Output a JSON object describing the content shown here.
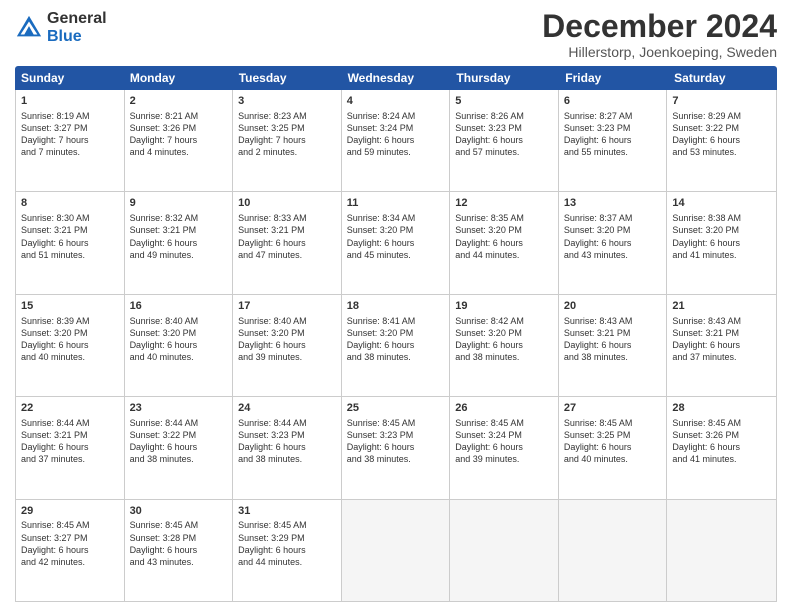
{
  "logo": {
    "general": "General",
    "blue": "Blue"
  },
  "title": "December 2024",
  "location": "Hillerstorp, Joenkoeping, Sweden",
  "days": [
    "Sunday",
    "Monday",
    "Tuesday",
    "Wednesday",
    "Thursday",
    "Friday",
    "Saturday"
  ],
  "weeks": [
    [
      {
        "day": 1,
        "info": "Sunrise: 8:19 AM\nSunset: 3:27 PM\nDaylight: 7 hours\nand 7 minutes."
      },
      {
        "day": 2,
        "info": "Sunrise: 8:21 AM\nSunset: 3:26 PM\nDaylight: 7 hours\nand 4 minutes."
      },
      {
        "day": 3,
        "info": "Sunrise: 8:23 AM\nSunset: 3:25 PM\nDaylight: 7 hours\nand 2 minutes."
      },
      {
        "day": 4,
        "info": "Sunrise: 8:24 AM\nSunset: 3:24 PM\nDaylight: 6 hours\nand 59 minutes."
      },
      {
        "day": 5,
        "info": "Sunrise: 8:26 AM\nSunset: 3:23 PM\nDaylight: 6 hours\nand 57 minutes."
      },
      {
        "day": 6,
        "info": "Sunrise: 8:27 AM\nSunset: 3:23 PM\nDaylight: 6 hours\nand 55 minutes."
      },
      {
        "day": 7,
        "info": "Sunrise: 8:29 AM\nSunset: 3:22 PM\nDaylight: 6 hours\nand 53 minutes."
      }
    ],
    [
      {
        "day": 8,
        "info": "Sunrise: 8:30 AM\nSunset: 3:21 PM\nDaylight: 6 hours\nand 51 minutes."
      },
      {
        "day": 9,
        "info": "Sunrise: 8:32 AM\nSunset: 3:21 PM\nDaylight: 6 hours\nand 49 minutes."
      },
      {
        "day": 10,
        "info": "Sunrise: 8:33 AM\nSunset: 3:21 PM\nDaylight: 6 hours\nand 47 minutes."
      },
      {
        "day": 11,
        "info": "Sunrise: 8:34 AM\nSunset: 3:20 PM\nDaylight: 6 hours\nand 45 minutes."
      },
      {
        "day": 12,
        "info": "Sunrise: 8:35 AM\nSunset: 3:20 PM\nDaylight: 6 hours\nand 44 minutes."
      },
      {
        "day": 13,
        "info": "Sunrise: 8:37 AM\nSunset: 3:20 PM\nDaylight: 6 hours\nand 43 minutes."
      },
      {
        "day": 14,
        "info": "Sunrise: 8:38 AM\nSunset: 3:20 PM\nDaylight: 6 hours\nand 41 minutes."
      }
    ],
    [
      {
        "day": 15,
        "info": "Sunrise: 8:39 AM\nSunset: 3:20 PM\nDaylight: 6 hours\nand 40 minutes."
      },
      {
        "day": 16,
        "info": "Sunrise: 8:40 AM\nSunset: 3:20 PM\nDaylight: 6 hours\nand 40 minutes."
      },
      {
        "day": 17,
        "info": "Sunrise: 8:40 AM\nSunset: 3:20 PM\nDaylight: 6 hours\nand 39 minutes."
      },
      {
        "day": 18,
        "info": "Sunrise: 8:41 AM\nSunset: 3:20 PM\nDaylight: 6 hours\nand 38 minutes."
      },
      {
        "day": 19,
        "info": "Sunrise: 8:42 AM\nSunset: 3:20 PM\nDaylight: 6 hours\nand 38 minutes."
      },
      {
        "day": 20,
        "info": "Sunrise: 8:43 AM\nSunset: 3:21 PM\nDaylight: 6 hours\nand 38 minutes."
      },
      {
        "day": 21,
        "info": "Sunrise: 8:43 AM\nSunset: 3:21 PM\nDaylight: 6 hours\nand 37 minutes."
      }
    ],
    [
      {
        "day": 22,
        "info": "Sunrise: 8:44 AM\nSunset: 3:21 PM\nDaylight: 6 hours\nand 37 minutes."
      },
      {
        "day": 23,
        "info": "Sunrise: 8:44 AM\nSunset: 3:22 PM\nDaylight: 6 hours\nand 38 minutes."
      },
      {
        "day": 24,
        "info": "Sunrise: 8:44 AM\nSunset: 3:23 PM\nDaylight: 6 hours\nand 38 minutes."
      },
      {
        "day": 25,
        "info": "Sunrise: 8:45 AM\nSunset: 3:23 PM\nDaylight: 6 hours\nand 38 minutes."
      },
      {
        "day": 26,
        "info": "Sunrise: 8:45 AM\nSunset: 3:24 PM\nDaylight: 6 hours\nand 39 minutes."
      },
      {
        "day": 27,
        "info": "Sunrise: 8:45 AM\nSunset: 3:25 PM\nDaylight: 6 hours\nand 40 minutes."
      },
      {
        "day": 28,
        "info": "Sunrise: 8:45 AM\nSunset: 3:26 PM\nDaylight: 6 hours\nand 41 minutes."
      }
    ],
    [
      {
        "day": 29,
        "info": "Sunrise: 8:45 AM\nSunset: 3:27 PM\nDaylight: 6 hours\nand 42 minutes."
      },
      {
        "day": 30,
        "info": "Sunrise: 8:45 AM\nSunset: 3:28 PM\nDaylight: 6 hours\nand 43 minutes."
      },
      {
        "day": 31,
        "info": "Sunrise: 8:45 AM\nSunset: 3:29 PM\nDaylight: 6 hours\nand 44 minutes."
      },
      null,
      null,
      null,
      null
    ]
  ]
}
